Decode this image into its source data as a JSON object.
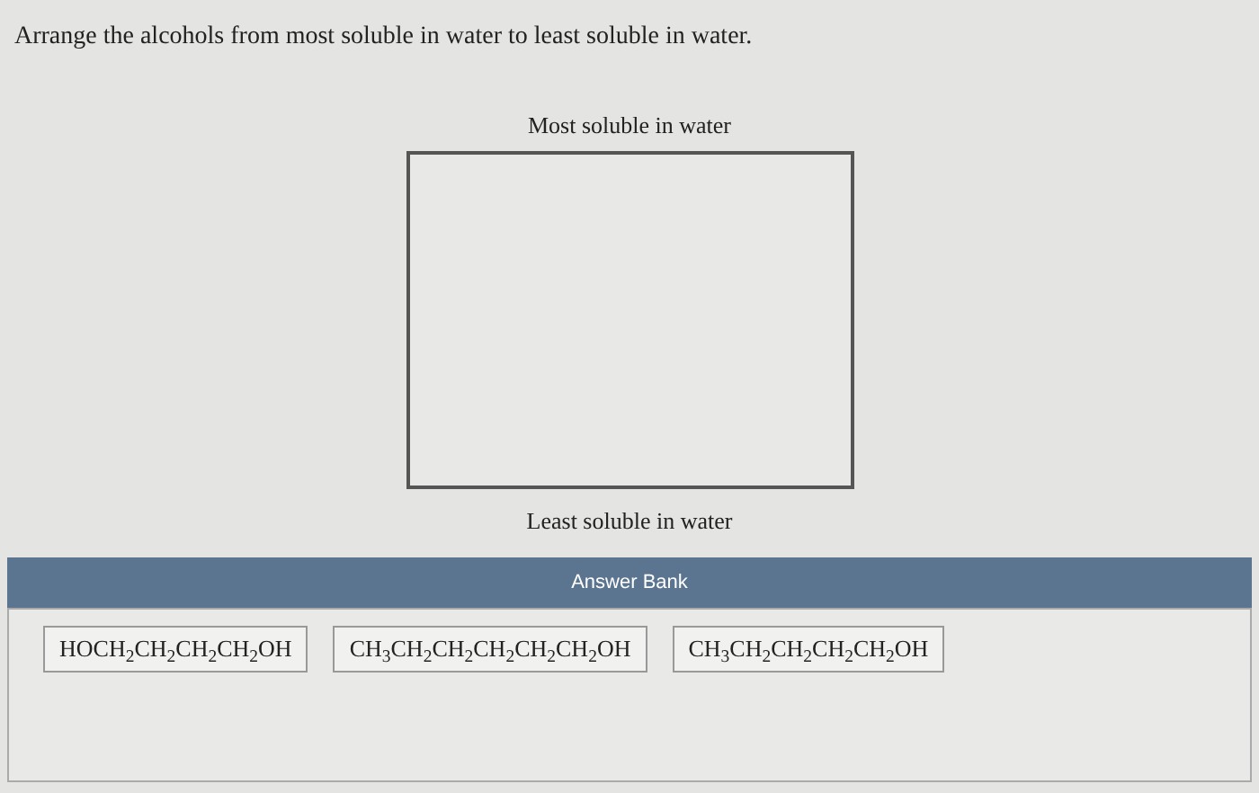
{
  "question": "Arrange the alcohols from most soluble in water to least soluble in water.",
  "ranking": {
    "top_label": "Most soluble in water",
    "bottom_label": "Least soluble in water"
  },
  "answer_bank": {
    "title": "Answer Bank",
    "items": [
      "HOCH$_{2}$CH$_{2}$CH$_{2}$CH$_{2}$OH",
      "CH$_{3}$CH$_{2}$CH$_{2}$CH$_{2}$CH$_{2}$CH$_{2}$OH",
      "CH$_{3}$CH$_{2}$CH$_{2}$CH$_{2}$CH$_{2}$OH"
    ]
  }
}
